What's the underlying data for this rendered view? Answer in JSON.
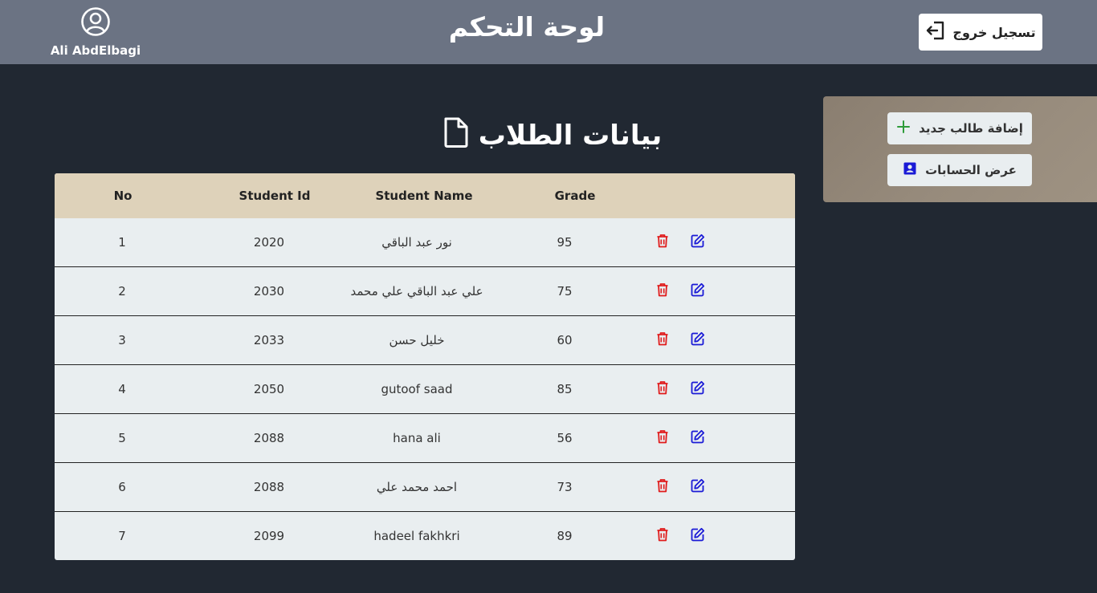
{
  "header": {
    "user_name": "Ali AbdElbagi",
    "title": "لوحة التحكم",
    "logout_label": "تسجيل خروج"
  },
  "sidebar": {
    "add_student_label": "إضافة طالب جديد",
    "view_accounts_label": "عرض الحسابات"
  },
  "main": {
    "section_title": "بيانات الطلاب"
  },
  "table": {
    "columns": {
      "no": "No",
      "student_id": "Student Id",
      "student_name": "Student Name",
      "grade": "Grade"
    },
    "rows": [
      {
        "no": "1",
        "student_id": "2020",
        "student_name": "نور عبد الباقي",
        "grade": "95"
      },
      {
        "no": "2",
        "student_id": "2030",
        "student_name": "علي عبد الباقي علي محمد",
        "grade": "75"
      },
      {
        "no": "3",
        "student_id": "2033",
        "student_name": "خليل حسن",
        "grade": "60"
      },
      {
        "no": "4",
        "student_id": "2050",
        "student_name": "gutoof saad",
        "grade": "85"
      },
      {
        "no": "5",
        "student_id": "2088",
        "student_name": "hana ali",
        "grade": "56"
      },
      {
        "no": "6",
        "student_id": "2088",
        "student_name": "احمد محمد علي",
        "grade": "73"
      },
      {
        "no": "7",
        "student_id": "2099",
        "student_name": "hadeel fakhkri",
        "grade": "89"
      }
    ]
  },
  "icons": {
    "user": "user-circle-icon",
    "logout": "logout-icon",
    "add": "plus-icon",
    "accounts": "contact-card-icon",
    "document": "file-icon",
    "delete": "trash-icon",
    "edit": "edit-icon"
  },
  "colors": {
    "header_bg": "#6b7383",
    "page_bg": "#212832",
    "table_head_bg": "#ded2ba",
    "table_body_bg": "#e9eef0",
    "delete": "#e01b1b",
    "edit": "#1a1ad6",
    "add": "#2e9c3a",
    "accounts": "#1a1ad6"
  }
}
